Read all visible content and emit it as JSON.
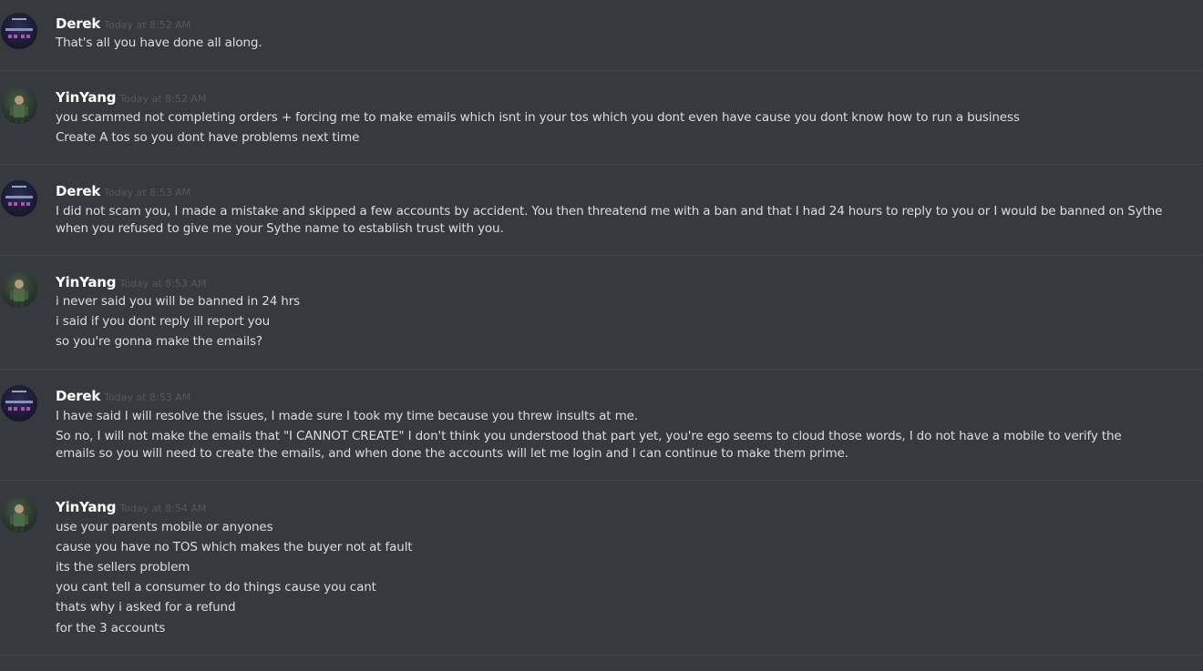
{
  "messages": [
    {
      "author": "Derek",
      "avatar": "derek-avatar",
      "timestamp": "Today at 8:52 AM",
      "lines": [
        "That's all you have done all along."
      ]
    },
    {
      "author": "YinYang",
      "avatar": "yinyang-avatar",
      "timestamp": "Today at 8:52 AM",
      "lines": [
        "you scammed not completing orders + forcing me to make emails which isnt in your tos which you dont even have cause you dont know how to run a business",
        "Create A tos so you dont have problems next time"
      ]
    },
    {
      "author": "Derek",
      "avatar": "derek-avatar",
      "timestamp": "Today at 8:53 AM",
      "lines": [
        "I did not scam you, I made a mistake and skipped a few accounts by accident. You then threatend me with a ban and that I had 24 hours to reply to you or I would be banned on Sythe when you refused to give me your Sythe name to establish trust with you."
      ]
    },
    {
      "author": "YinYang",
      "avatar": "yinyang-avatar",
      "timestamp": "Today at 8:53 AM",
      "lines": [
        "i never said you will be banned in 24 hrs",
        "i said if you dont reply ill report you",
        "so you're gonna make the emails?"
      ]
    },
    {
      "author": "Derek",
      "avatar": "derek-avatar",
      "timestamp": "Today at 8:53 AM",
      "lines": [
        "I have said I will resolve the issues, I made sure I took my time because you threw insults at me.",
        "So no, I will not make the emails that \"I CANNOT CREATE\" I don't think you understood that part yet, you're ego seems to cloud those words, I do not have a mobile to verify the emails so you will need to create the emails, and when done the accounts will let me login and I can continue to make them prime."
      ]
    },
    {
      "author": "YinYang",
      "avatar": "yinyang-avatar",
      "timestamp": "Today at 8:54 AM",
      "lines": [
        "use your parents mobile or anyones",
        "cause you have no TOS which makes the buyer not at fault",
        "its the sellers problem",
        "you cant tell a consumer to do things cause you cant",
        "thats why i asked for a refund",
        "for the 3 accounts"
      ]
    }
  ]
}
